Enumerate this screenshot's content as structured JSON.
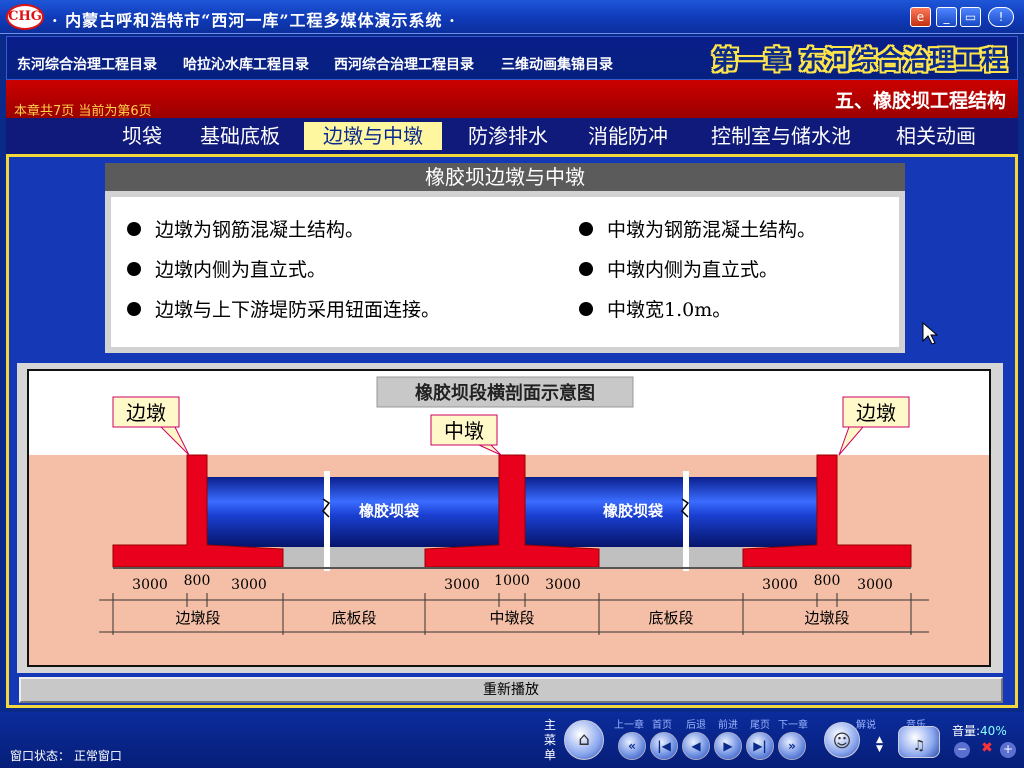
{
  "app": {
    "title": "· 内蒙古呼和浩特市“西河一库”工程多媒体演示系统 ·",
    "logo_text": "CHG",
    "window_controls": [
      "e",
      "_",
      "▭",
      "!"
    ]
  },
  "menu": {
    "items": [
      "东河综合治理工程目录",
      "哈拉沁水库工程目录",
      "西河综合治理工程目录",
      "三维动画集锦目录"
    ],
    "chapter_title": "第一章  东河综合治理工程"
  },
  "section": {
    "page_info": "本章共7页    当前为第6页",
    "title": "五、橡胶坝工程结构"
  },
  "tabs": {
    "items": [
      "坝袋",
      "基础底板",
      "边墩与中墩",
      "防渗排水",
      "消能防冲",
      "控制室与储水池",
      "相关动画"
    ],
    "active_index": 2
  },
  "panel": {
    "title": "橡胶坝边墩与中墩",
    "left_bullets": [
      "边墩为钢筋混凝土结构。",
      "边墩内侧为直立式。",
      "边墩与上下游堤防采用钮面连接。"
    ],
    "right_bullets": [
      "中墩为钢筋混凝土结构。",
      "中墩内侧为直立式。",
      "中墩宽1.0m。"
    ]
  },
  "diagram": {
    "title": "橡胶坝段横剖面示意图",
    "callouts": [
      "边墩",
      "中墩",
      "边墩"
    ],
    "bag_labels": [
      "橡胶坝袋",
      "橡胶坝袋"
    ],
    "dimensions": [
      "3000",
      "800",
      "3000",
      "3000",
      "1000",
      "3000",
      "3000",
      "800",
      "3000"
    ],
    "segments": [
      "边墩段",
      "底板段",
      "中墩段",
      "底板段",
      "边墩段"
    ],
    "colors": {
      "soil": "#f4bfa6",
      "pier": "#e8001c",
      "bag": "#1a3fd0",
      "base_gray": "#c0c0c0"
    }
  },
  "replay_label": "重新播放",
  "bottom": {
    "window_status": "窗口状态：  正常窗口",
    "main_menu": "主菜单",
    "nav_labels": [
      "上一章",
      "首页",
      "后退",
      "前进",
      "尾页",
      "下一章"
    ],
    "explain_label": "解说",
    "music_label": "音乐",
    "volume_label": "音量:",
    "volume_value": "40%"
  }
}
